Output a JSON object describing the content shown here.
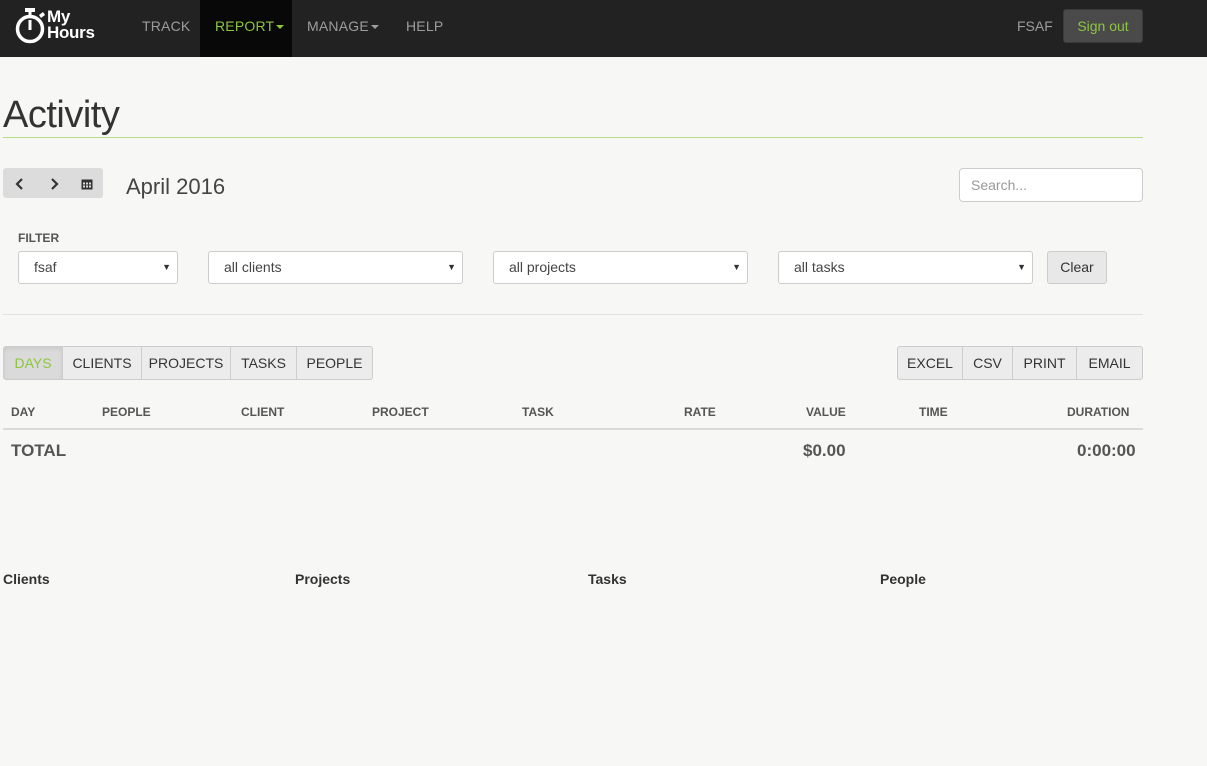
{
  "app": {
    "logo_line1": "My",
    "logo_line2": "Hours",
    "nav": [
      "TRACK",
      "REPORT",
      "MANAGE",
      "HELP"
    ],
    "user": "FSAF",
    "signout": "Sign out"
  },
  "page": {
    "title": "Activity",
    "period": "April 2016",
    "search_placeholder": "Search..."
  },
  "filter": {
    "label": "FILTER",
    "people": "fsaf",
    "clients": "all clients",
    "projects": "all projects",
    "tasks": "all tasks",
    "clear": "Clear"
  },
  "view_tabs": [
    "DAYS",
    "CLIENTS",
    "PROJECTS",
    "TASKS",
    "PEOPLE"
  ],
  "export_buttons": [
    "EXCEL",
    "CSV",
    "PRINT",
    "EMAIL"
  ],
  "table": {
    "headers": [
      "DAY",
      "PEOPLE",
      "CLIENT",
      "PROJECT",
      "TASK",
      "RATE",
      "VALUE",
      "TIME",
      "DURATION"
    ],
    "total_label": "TOTAL",
    "total_value": "$0.00",
    "total_duration": "0:00:00"
  },
  "sections": [
    "Clients",
    "Projects",
    "Tasks",
    "People"
  ],
  "colors": {
    "accent": "#8cc63f",
    "navbar": "#222222"
  }
}
